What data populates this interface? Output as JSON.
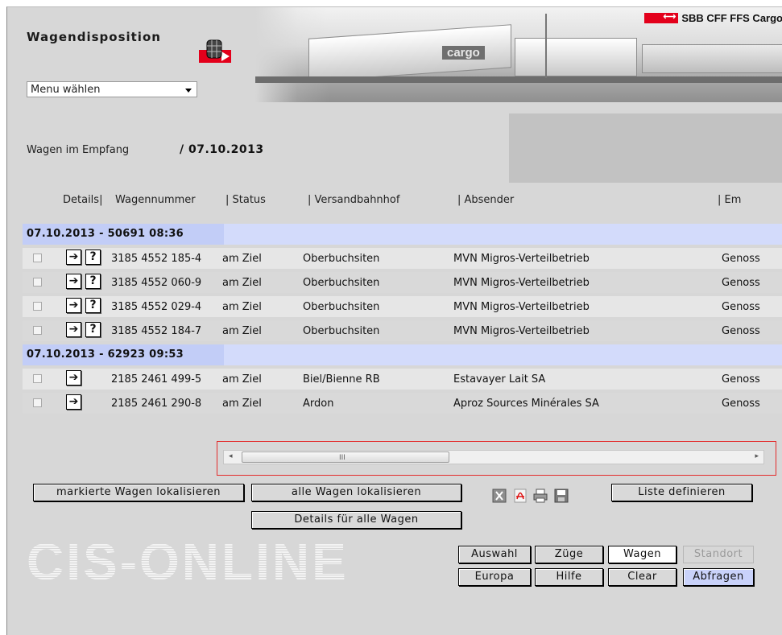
{
  "app": {
    "title": "Wagendisposition",
    "brand": "SBB CFF FFS Cargo",
    "banner_tag": "cargo",
    "logo_text": "CIS-ONLINE"
  },
  "menu": {
    "selected": "Menu wählen"
  },
  "empfang": {
    "label": "Wagen im Empfang",
    "date": "/ 07.10.2013"
  },
  "table": {
    "headers": [
      "Details|",
      "Wagennummer",
      "| Status",
      "| Versandbahnhof",
      "| Absender",
      "| Em"
    ],
    "groups": [
      {
        "label": "07.10.2013 - 50691 08:36",
        "rows": [
          {
            "wagennummer": "3185 4552 185-4",
            "status": "am Ziel",
            "versandbahnhof": "Oberbuchsiten",
            "absender": "MVN Migros-Verteilbetrieb",
            "empfaenger": "Genoss"
          },
          {
            "wagennummer": "3185 4552 060-9",
            "status": "am Ziel",
            "versandbahnhof": "Oberbuchsiten",
            "absender": "MVN Migros-Verteilbetrieb",
            "empfaenger": "Genoss"
          },
          {
            "wagennummer": "3185 4552 029-4",
            "status": "am Ziel",
            "versandbahnhof": "Oberbuchsiten",
            "absender": "MVN Migros-Verteilbetrieb",
            "empfaenger": "Genoss"
          },
          {
            "wagennummer": "3185 4552 184-7",
            "status": "am Ziel",
            "versandbahnhof": "Oberbuchsiten",
            "absender": "MVN Migros-Verteilbetrieb",
            "empfaenger": "Genoss"
          }
        ]
      },
      {
        "label": "07.10.2013 - 62923 09:53",
        "rows": [
          {
            "wagennummer": "2185 2461 499-5",
            "status": "am Ziel",
            "versandbahnhof": "Biel/Bienne RB",
            "absender": "Estavayer Lait SA",
            "empfaenger": "Genoss"
          },
          {
            "wagennummer": "2185 2461 290-8",
            "status": "am Ziel",
            "versandbahnhof": "Ardon",
            "absender": "Aproz Sources Minérales SA",
            "empfaenger": "Genoss"
          }
        ]
      }
    ],
    "arrow_glyph": "➔",
    "question_glyph": "?"
  },
  "scrollbar": {
    "grip": "III",
    "left": "◂",
    "right": "▸"
  },
  "buttons": {
    "markierte": "markierte Wagen lokalisieren",
    "alle": "alle Wagen lokalisieren",
    "details_alle": "Details für alle Wagen",
    "liste": "Liste definieren",
    "auswahl": "Auswahl",
    "zuege": "Züge",
    "wagen": "Wagen",
    "standort": "Standort",
    "europa": "Europa",
    "hilfe": "Hilfe",
    "clear": "Clear",
    "abfragen": "Abfragen"
  },
  "toolbar_icons": [
    "excel-icon",
    "pdf-icon",
    "print-icon",
    "save-icon"
  ],
  "colors": {
    "accent_red": "#e3001b",
    "group_row": "#c2cdf7",
    "highlight_frame": "#e32b2b",
    "active_button": "#c9d2fa"
  }
}
